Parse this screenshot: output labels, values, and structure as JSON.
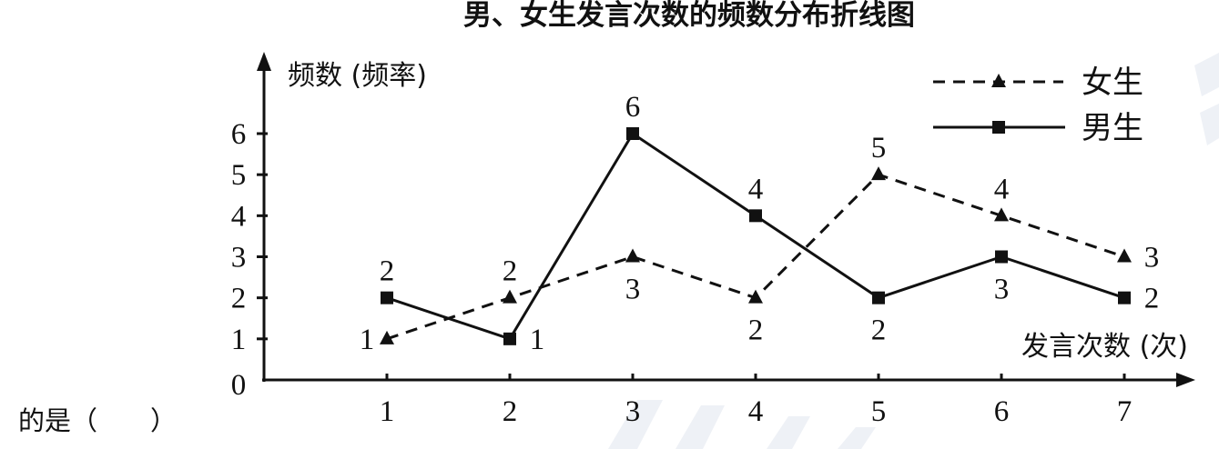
{
  "question_fragment": "的是（　　）",
  "chart_data": {
    "type": "line",
    "title": "男、女生发言次数的频数分布折线图",
    "xlabel": "发言次数 (次)",
    "ylabel": "频数 (频率)",
    "x": [
      1,
      2,
      3,
      4,
      5,
      6,
      7
    ],
    "x_ticks": [
      1,
      2,
      3,
      4,
      5,
      6,
      7
    ],
    "y_ticks": [
      0,
      1,
      2,
      3,
      4,
      5,
      6
    ],
    "xlim": [
      0,
      7
    ],
    "ylim": [
      0,
      6
    ],
    "grid": false,
    "legend": "top-right",
    "series": [
      {
        "name": "女生",
        "values": [
          1,
          2,
          3,
          2,
          5,
          4,
          3
        ],
        "line_style": "dashed",
        "marker": "triangle",
        "color": "#111111"
      },
      {
        "name": "男生",
        "values": [
          2,
          1,
          6,
          4,
          2,
          3,
          2
        ],
        "line_style": "solid",
        "marker": "square",
        "color": "#111111"
      }
    ]
  }
}
